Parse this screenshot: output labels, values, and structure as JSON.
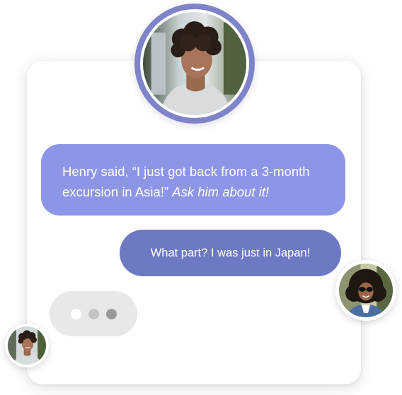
{
  "chat": {
    "received_message": {
      "text_plain": "Henry said, “I just got back from a 3-month excursion in Asia!” ",
      "text_italic": "Ask him about it!"
    },
    "sent_message": "What part? I was just in Japan!",
    "typing_indicator": {
      "dot_colors": [
        "#ffffff",
        "#c4c4c4",
        "#9a9a9a"
      ]
    }
  },
  "avatars": {
    "top": "man-curly-hair-avatar",
    "right": "woman-sunglasses-avatar",
    "left": "man-curly-hair-avatar-small"
  },
  "colors": {
    "received_bubble": "#8d96e6",
    "sent_bubble": "#6e79c4",
    "avatar_ring": "#7f83c9",
    "typing_bubble": "#e8e8e8"
  }
}
